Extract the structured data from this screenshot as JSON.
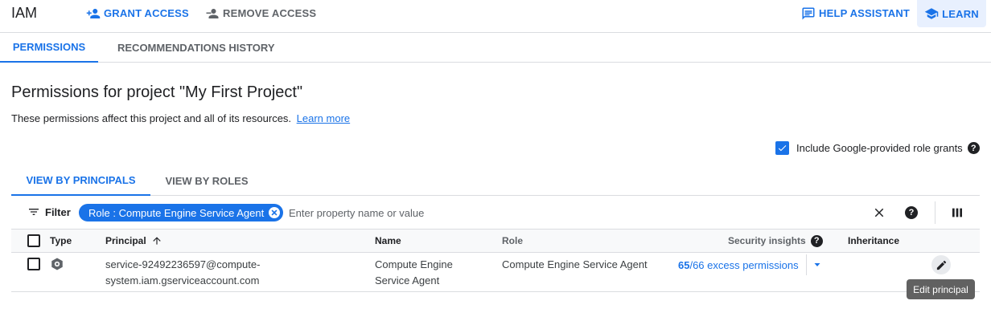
{
  "header": {
    "title": "IAM",
    "grant_access": "GRANT ACCESS",
    "remove_access": "REMOVE ACCESS",
    "help_assistant": "HELP ASSISTANT",
    "learn": "LEARN"
  },
  "main_tabs": [
    "PERMISSIONS",
    "RECOMMENDATIONS HISTORY"
  ],
  "page": {
    "title": "Permissions for project \"My First Project\"",
    "description": "These permissions affect this project and all of its resources.",
    "learn_more": "Learn more"
  },
  "include_google_grants": {
    "label": "Include Google-provided role grants",
    "checked": true
  },
  "view_tabs": [
    "VIEW BY PRINCIPALS",
    "VIEW BY ROLES"
  ],
  "filter": {
    "label": "Filter",
    "chip": "Role : Compute Engine Service Agent",
    "placeholder": "Enter property name or value"
  },
  "table": {
    "columns": {
      "type": "Type",
      "principal": "Principal",
      "name": "Name",
      "role": "Role",
      "security_insights": "Security insights",
      "inheritance": "Inheritance"
    },
    "rows": [
      {
        "principal_line1": "service-92492236597@compute-",
        "principal_line2": "system.iam.gserviceaccount.com",
        "name_line1": "Compute Engine",
        "name_line2": "Service Agent",
        "role": "Compute Engine Service Agent",
        "insight_count": "65",
        "insight_text": "/66 excess permissions",
        "inheritance": ""
      }
    ]
  },
  "tooltip": "Edit principal",
  "colors": {
    "accent": "#1a73e8",
    "text": "#202124",
    "muted": "#5f6368",
    "divider": "#dadce0"
  }
}
